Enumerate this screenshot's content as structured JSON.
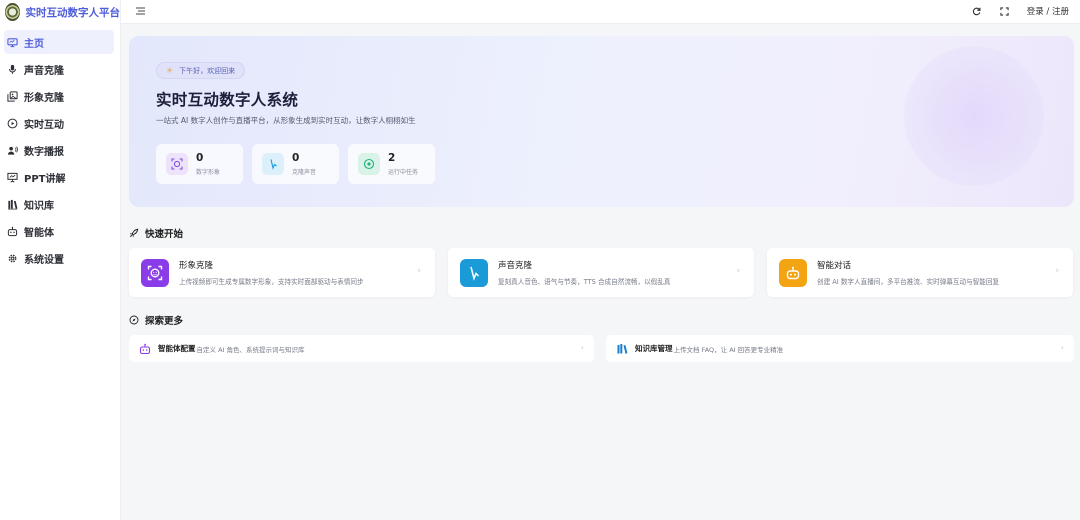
{
  "app": {
    "title": "实时互动数字人平台"
  },
  "sidebar": {
    "items": [
      {
        "label": "主页",
        "icon": "monitor-icon",
        "active": true
      },
      {
        "label": "声音克隆",
        "icon": "microphone-icon"
      },
      {
        "label": "形象克隆",
        "icon": "image-stack-icon"
      },
      {
        "label": "实时互动",
        "icon": "play-circle-icon"
      },
      {
        "label": "数字播报",
        "icon": "broadcast-user-icon"
      },
      {
        "label": "PPT讲解",
        "icon": "presentation-icon"
      },
      {
        "label": "知识库",
        "icon": "books-icon"
      },
      {
        "label": "智能体",
        "icon": "robot-icon"
      },
      {
        "label": "系统设置",
        "icon": "gear-icon"
      }
    ]
  },
  "topbar": {
    "login_label": "登录 / 注册",
    "icons": [
      "menu-icon",
      "refresh-icon",
      "fullscreen-icon"
    ]
  },
  "hero": {
    "greeting": "下午好，欢迎回来",
    "title": "实时互动数字人系统",
    "subtitle": "一站式 AI 数字人创作与直播平台，从形象生成到实时互动，让数字人栩栩如生",
    "stats": [
      {
        "value": "0",
        "label": "数字形象",
        "color": "#7c4dde"
      },
      {
        "value": "0",
        "label": "克隆声音",
        "color": "#1a9bd8"
      },
      {
        "value": "2",
        "label": "运行中任务",
        "color": "#22b07d"
      }
    ]
  },
  "quick_start": {
    "title": "快速开始",
    "cards": [
      {
        "title": "形象克隆",
        "desc": "上传视频即可生成专属数字形象，支持实时面部驱动与表情同步",
        "color": "#8a3ce8"
      },
      {
        "title": "声音克隆",
        "desc": "复刻真人音色、语气与节奏，TTS 合成自然流畅，以假乱真",
        "color": "#1a9bd8"
      },
      {
        "title": "智能对话",
        "desc": "创建 AI 数字人直播间，多平台推流、实时弹幕互动与智能回复",
        "color": "#f2a413"
      }
    ]
  },
  "explore": {
    "title": "探索更多",
    "cards": [
      {
        "title": "智能体配置",
        "desc": "自定义 AI 角色、系统提示词与知识库"
      },
      {
        "title": "知识库管理",
        "desc": "上传文档 FAQ，让 AI 回答更专业精准"
      }
    ]
  }
}
